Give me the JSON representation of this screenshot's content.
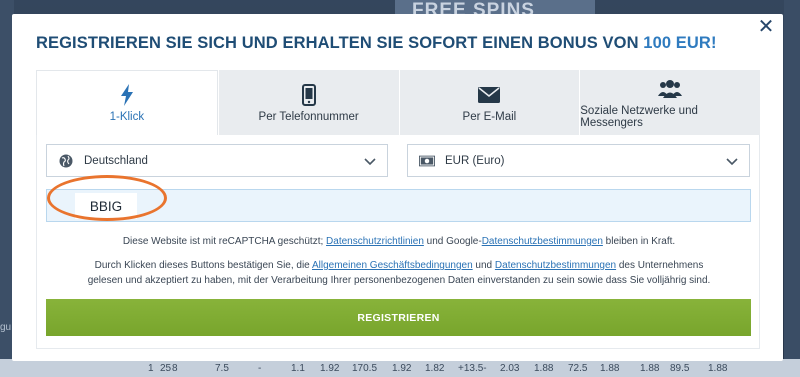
{
  "background": {
    "banner_text": "FREE SPINS",
    "left_label": "gu",
    "bottom_row": [
      "1",
      "25",
      "8",
      "7.5",
      "-",
      "1.1",
      "1.92",
      "170.5",
      "1.92",
      "1.82",
      "+13.5-",
      "2.03",
      "1.88",
      "72.5",
      "1.88",
      "1.88",
      "89.5",
      "1.88"
    ]
  },
  "modal": {
    "close_symbol": "✕",
    "title_prefix": "REGISTRIEREN SIE SICH UND ERHALTEN SIE SOFORT EINEN BONUS VON ",
    "title_amount": "100 EUR!",
    "tabs": [
      {
        "label": "1-Klick",
        "icon": "lightning-icon",
        "active": true
      },
      {
        "label": "Per Telefonnummer",
        "icon": "phone-icon",
        "active": false
      },
      {
        "label": "Per E-Mail",
        "icon": "envelope-icon",
        "active": false
      },
      {
        "label": "Soziale Netzwerke und Messengers",
        "icon": "people-icon",
        "active": false
      }
    ],
    "country_select": {
      "value": "Deutschland",
      "icon": "globe-icon"
    },
    "currency_select": {
      "value": "EUR (Euro)",
      "icon": "banknote-icon"
    },
    "promo_code": "BBIG",
    "notice1": {
      "part1": "Diese Website ist mit reCAPTCHA geschützt; ",
      "link1": "Datenschutzrichtlinien",
      "part2": " und Google-",
      "link2": "Datenschutzbestimmungen",
      "part3": " bleiben in Kraft."
    },
    "notice2": {
      "part1": "Durch Klicken dieses Buttons bestätigen Sie, die ",
      "link1": "Allgemeinen Geschäftsbedingungen",
      "part2": " und ",
      "link2": "Datenschutzbestimmungen",
      "part3": " des Unternehmens",
      "line2": "gelesen und akzeptiert zu haben, mit der Verarbeitung Ihrer personenbezogenen Daten einverstanden zu sein sowie dass Sie volljährig sind."
    },
    "register_label": "REGISTRIEREN",
    "colors": {
      "accent": "#2a72b5",
      "title": "#1f4d75",
      "button": "#7fac34",
      "highlight": "#e9742e"
    }
  }
}
